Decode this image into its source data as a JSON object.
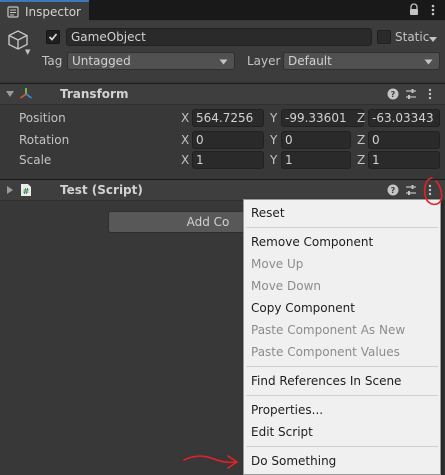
{
  "tab": {
    "title": "Inspector"
  },
  "header": {
    "object_name": "GameObject",
    "static_label": "Static",
    "tag_label": "Tag",
    "tag_value": "Untagged",
    "layer_label": "Layer",
    "layer_value": "Default"
  },
  "transform": {
    "title": "Transform",
    "rows": [
      {
        "label": "Position",
        "x": "564.7256",
        "y": "-99.33601",
        "z": "-63.03343"
      },
      {
        "label": "Rotation",
        "x": "0",
        "y": "0",
        "z": "0"
      },
      {
        "label": "Scale",
        "x": "1",
        "y": "1",
        "z": "1"
      }
    ],
    "axis": {
      "x": "X",
      "y": "Y",
      "z": "Z"
    }
  },
  "script_component": {
    "title": "Test (Script)"
  },
  "add_component": {
    "label": "Add Co"
  },
  "context_menu": {
    "items": [
      {
        "label": "Reset",
        "enabled": true
      },
      {
        "label": "Remove Component",
        "enabled": true
      },
      {
        "label": "Move Up",
        "enabled": false
      },
      {
        "label": "Move Down",
        "enabled": false
      },
      {
        "label": "Copy Component",
        "enabled": true
      },
      {
        "label": "Paste Component As New",
        "enabled": false
      },
      {
        "label": "Paste Component Values",
        "enabled": false
      },
      {
        "label": "Find References In Scene",
        "enabled": true
      },
      {
        "label": "Properties...",
        "enabled": true
      },
      {
        "label": "Edit Script",
        "enabled": true
      },
      {
        "label": "Do Something",
        "enabled": true
      }
    ]
  },
  "colors": {
    "panel_bg": "#383838",
    "header_bg": "#3c3c3c",
    "tab_accent": "#3a79bb",
    "menu_bg": "#f0f0f0",
    "annotation_red": "#e8202a"
  },
  "icons": [
    "inspector-icon",
    "lock-icon",
    "more-icon",
    "gameobject-cube-icon",
    "transform-axes-icon",
    "script-icon",
    "help-icon",
    "preset-icon"
  ]
}
